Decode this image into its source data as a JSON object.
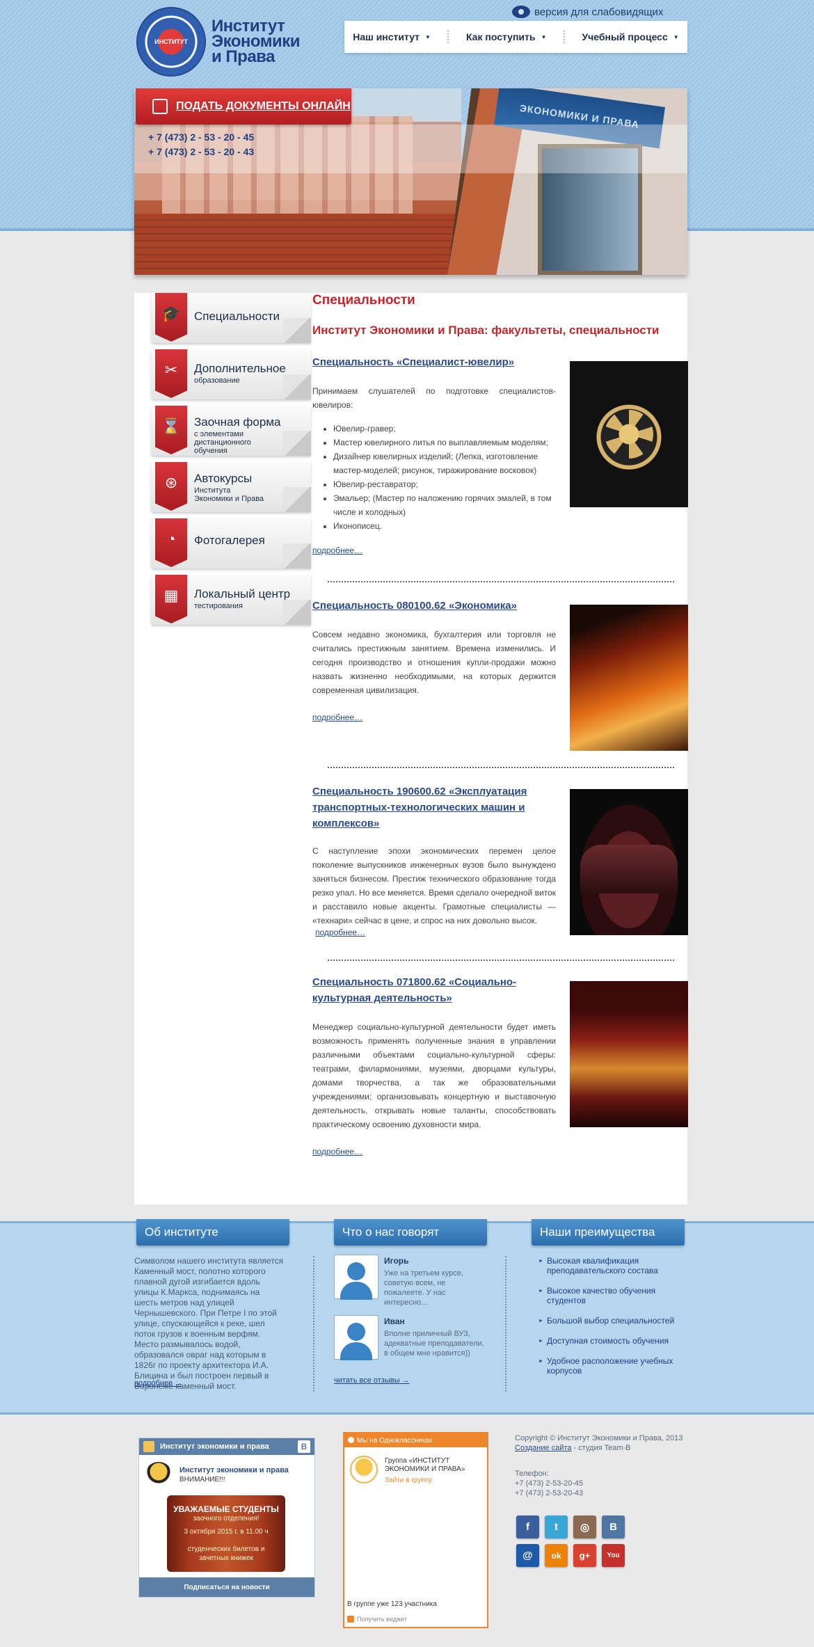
{
  "header": {
    "logo_line1": "Институт",
    "logo_line2": "Экономики",
    "logo_line3": "и Права",
    "emblem_text": "ИНСТИТУТ",
    "vision_label": "версия для слабовидящих",
    "nav": [
      {
        "label": "Наш институт"
      },
      {
        "label": "Как поступить"
      },
      {
        "label": "Учебный процесс"
      }
    ],
    "submit_button": "Подать документы онлайн",
    "phones": [
      "+ 7 (473) 2 - 53 - 20 - 45",
      "+ 7 (473) 2 - 53 - 20 - 43"
    ],
    "sign_text": "ЭКОНОМИКИ И ПРАВА"
  },
  "sidebar": {
    "items": [
      {
        "title": "Специальности",
        "sub": "",
        "icon": "graduation-cap-icon"
      },
      {
        "title": "Дополнительное",
        "sub": "образование",
        "icon": "tools-icon"
      },
      {
        "title": "Заочная форма",
        "sub": "с элементами дистанционного обучения",
        "icon": "hourglass-icon"
      },
      {
        "title": "Автокурсы",
        "sub": "Института Экономики и Права",
        "icon": "steering-wheel-icon"
      },
      {
        "title": "Фотогалерея",
        "sub": "",
        "icon": "rss-icon"
      },
      {
        "title": "Локальный центр",
        "sub": "тестирования",
        "icon": "calendar-icon"
      }
    ]
  },
  "content": {
    "title": "Специальности",
    "subtitle": "Институт Экономики и Права: факультеты, специальности",
    "more_label": "подробнее…",
    "articles": [
      {
        "title": "Специальность «Специалист-ювелир»",
        "text": "Принимаем слушателей по подготовке специалистов-ювелиров:",
        "list": [
          "Ювелир-гравер;",
          "Мастер ювелирного литья по выплавляемым моделям;",
          "Дизайнер ювелирных изделий; (Лепка, изготовление мастер-моделей; рисунок, тиражирование восковок)",
          "Ювелир-реставратор;",
          "Эмальер; (Мастер по наложению горячих эмалей, в том числе и холодных)",
          "Иконописец."
        ]
      },
      {
        "title": "Специальность 080100.62 «Экономика»",
        "text": "Совсем недавно экономика, бухгалтерия или торговля не считались престижным занятием. Времена изменились. И сегодня производство и отношения купли-продажи можно назвать жизненно необходимыми, на которых держится современная цивилизация."
      },
      {
        "title": "Специальность 190600.62 «Эксплуатация транспортных-технологических машин и комплексов»",
        "text": "С наступление эпохи экономических перемен целое поколение выпускников инженерных вузов было вынуждено заняться бизнесом. Престиж технического образование тогда резко упал. Но все меняется. Время сделало очередной виток и расставило новые акценты. Грамотные специалисты — «технари» сейчас в цене, и спрос на них довольно высок."
      },
      {
        "title": "Специальность 071800.62 «Социально-культурная деятельность»",
        "text": "Менеджер социально-культурной деятельности будет иметь возможность применять полученные знания в управлении различными объектами социально-культурной сферы: театрами, филармониями, музеями, дворцами культуры, домами творчества, а так же образовательными учреждениями; организовывать концертную и выставочную деятельность, открывать новые таланты, способствовать практическому освоению духовности мира."
      }
    ]
  },
  "info": {
    "about_tab": "Об институте",
    "reviews_tab": "Что о нас говорят",
    "advantages_tab": "Наши преимущества",
    "about_text": "Символом нашего института является Каменный мост, полотно которого плавной дугой изгибается вдоль улицы К.Маркса, поднимаясь на шесть метров над улицей Чернышевского. При Петре I по этой улице, спускающейся к реке, шел поток грузов к военным верфям. Место размывалось водой, образовался овраг над которым в 1826г по проекту архитектора И.А. Блицина и был построен первый в Воронеже каменный мост.",
    "about_more": "подробнее",
    "reviews": [
      {
        "name": "Игорь",
        "text": "Уже на третьем курсе, советую всем, не пожалеете. У нас интересно..."
      },
      {
        "name": "Иван",
        "text": "Вполне приличный ВУЗ, адекватные преподаватели, в общем мне нравится))"
      }
    ],
    "reviews_more": "читать все отзывы",
    "advantages": [
      "Высокая квалификация преподавательского состава",
      "Высокое качество обучения студентов",
      "Большой выбор специальностей",
      "Доступная стоимость обучения",
      "Удобное расположение учебных корпусов"
    ]
  },
  "footer": {
    "vk": {
      "header": "Институт экономики и права",
      "logo": "B",
      "post_title": "Институт экономики и права",
      "post_sub": "ВНИМАНИЕ!!!",
      "scroll_line1": "УВАЖАЕМЫЕ СТУДЕНТЫ",
      "scroll_line2": "заочного отделения!",
      "scroll_line3": "3 октября 2015 г. в 11.00 ч",
      "scroll_line4": "студенческих билетов и",
      "scroll_line5": "зачетных книжек",
      "subscribe": "Подписаться на новости"
    },
    "ok": {
      "header": "Мы на Одноклассниках",
      "group": "Группа «ИНСТИТУТ ЭКОНОМИКИ И ПРАВА»",
      "join": "Зайти в группу",
      "members": "В группе уже 123 участника",
      "get_widget": "Получить виджет"
    },
    "copyright": "Copyright © Институт Экономики и Права, 2013",
    "site_link": "Создание сайта",
    "studio": " - студия Team-B",
    "tel_label": "Телефон:",
    "tels": [
      "+7 (473) 2-53-20-45",
      "+7 (473) 2-53-20-43"
    ],
    "socials": [
      {
        "name": "facebook",
        "glyph": "f",
        "color": "#3b5f9a"
      },
      {
        "name": "twitter",
        "glyph": "t",
        "color": "#3aa6d8"
      },
      {
        "name": "instagram",
        "glyph": "◎",
        "color": "#8a6a52"
      },
      {
        "name": "vkontakte",
        "glyph": "B",
        "color": "#4f76a3"
      },
      {
        "name": "mail",
        "glyph": "@",
        "color": "#1f5aa8"
      },
      {
        "name": "odnoklassniki",
        "glyph": "ok",
        "color": "#ee8208"
      },
      {
        "name": "google-plus",
        "glyph": "g+",
        "color": "#d8402f"
      },
      {
        "name": "youtube",
        "glyph": "You",
        "color": "#c4302b"
      }
    ]
  }
}
